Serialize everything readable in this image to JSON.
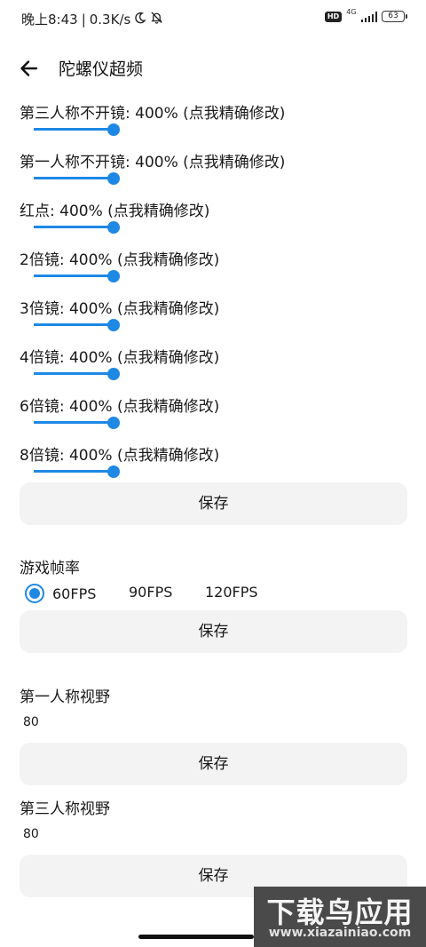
{
  "status_bar": {
    "time": "晚上8:43",
    "separator": "|",
    "network_speed": "0.3K/s",
    "hd_badge": "HD",
    "network_type": "4G",
    "battery": "63"
  },
  "header": {
    "title": "陀螺仪超频"
  },
  "sensitivity": {
    "items": [
      {
        "label": "第三人称不开镜: 400% (点我精确修改)",
        "value": 400
      },
      {
        "label": "第一人称不开镜: 400% (点我精确修改)",
        "value": 400
      },
      {
        "label": "红点: 400% (点我精确修改)",
        "value": 400
      },
      {
        "label": "2倍镜: 400% (点我精确修改)",
        "value": 400
      },
      {
        "label": "3倍镜: 400% (点我精确修改)",
        "value": 400
      },
      {
        "label": "4倍镜: 400% (点我精确修改)",
        "value": 400
      },
      {
        "label": "6倍镜: 400% (点我精确修改)",
        "value": 400
      },
      {
        "label": "8倍镜: 400% (点我精确修改)",
        "value": 400
      }
    ],
    "save_label": "保存"
  },
  "frame_rate": {
    "title": "游戏帧率",
    "options": [
      "60FPS",
      "90FPS",
      "120FPS"
    ],
    "selected": "60FPS",
    "save_label": "保存"
  },
  "fov_first_person": {
    "title": "第一人称视野",
    "value": "80",
    "save_label": "保存"
  },
  "fov_third_person": {
    "title": "第三人称视野",
    "value": "80",
    "save_label": "保存"
  },
  "watermark": {
    "title": "下载鸟应用",
    "url": "www.xiazainiao.com"
  },
  "colors": {
    "accent": "#1e88e5",
    "button_bg": "#f3f3f3"
  }
}
